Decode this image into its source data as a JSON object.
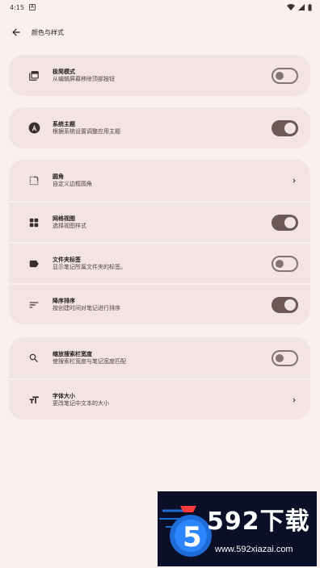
{
  "status": {
    "time": "4:15",
    "notify_glyph": "A"
  },
  "appbar": {
    "title": "颜色与样式",
    "back_icon": "arrow-back-icon"
  },
  "groups": [
    {
      "items": [
        {
          "icon": "layers-icon",
          "title": "极简模式",
          "subtitle": "从编辑屏幕移除顶部按钮",
          "control": "switch",
          "checked": false
        }
      ]
    },
    {
      "items": [
        {
          "icon": "theme-a-icon",
          "title": "系统主题",
          "subtitle": "根据系统设置调整应用主题",
          "control": "switch",
          "checked": true
        }
      ]
    },
    {
      "items": [
        {
          "icon": "rounded-corner-icon",
          "title": "圆角",
          "subtitle": "自定义边框圆角",
          "control": "chevron"
        },
        {
          "icon": "grid-view-icon",
          "title": "网格视图",
          "subtitle": "选择视图样式",
          "control": "switch",
          "checked": true
        },
        {
          "icon": "label-icon",
          "title": "文件夹标签",
          "subtitle": "显示笔记所属文件夹的标签。",
          "control": "switch",
          "checked": false
        },
        {
          "icon": "sort-icon",
          "title": "降序排序",
          "subtitle": "按创建时间对笔记进行排序",
          "control": "switch",
          "checked": true
        }
      ]
    },
    {
      "items": [
        {
          "icon": "search-icon",
          "title": "缩放搜索栏宽度",
          "subtitle": "使搜索栏宽度与笔记宽度匹配",
          "control": "switch",
          "checked": false
        },
        {
          "icon": "text-size-icon",
          "title": "字体大小",
          "subtitle": "更改笔记中文本的大小",
          "control": "chevron"
        }
      ]
    }
  ],
  "ad": {
    "brand": "592下载",
    "url": "www.592xiazai.com"
  }
}
